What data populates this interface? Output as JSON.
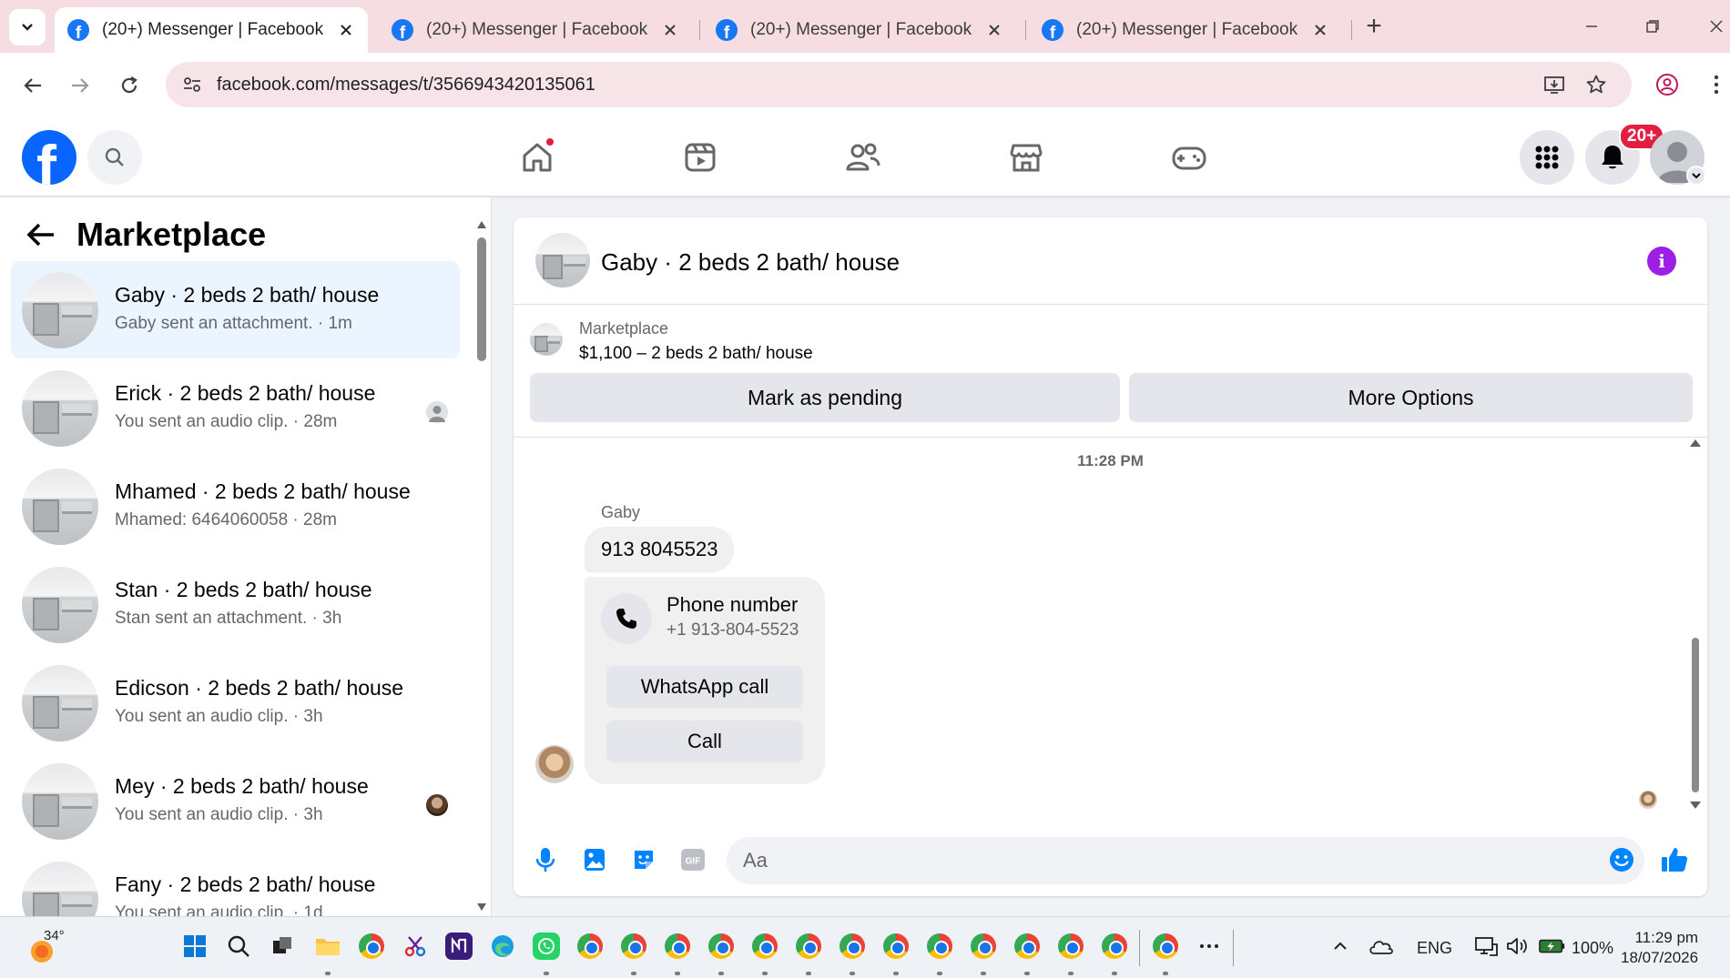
{
  "browser": {
    "tabs": [
      {
        "title": "(20+) Messenger | Facebook",
        "active": true
      },
      {
        "title": "(20+) Messenger | Facebook",
        "active": false
      },
      {
        "title": "(20+) Messenger | Facebook",
        "active": false
      },
      {
        "title": "(20+) Messenger | Facebook",
        "active": false
      }
    ],
    "favicon_letter": "f",
    "new_tab_label": "+",
    "url": "facebook.com/messages/t/3566943420135061"
  },
  "facebook": {
    "logo_letter": "f",
    "notification_badge": "20+"
  },
  "sidebar": {
    "title": "Marketplace",
    "conversations": [
      {
        "name": "Gaby · 2 beds 2 bath/ house",
        "snippet": "Gaby sent an attachment. · 1m",
        "active": true,
        "seen": "none"
      },
      {
        "name": "Erick · 2 beds 2 bath/ house",
        "snippet": "You sent an audio clip. · 28m",
        "active": false,
        "seen": "default-avatar"
      },
      {
        "name": "Mhamed · 2 beds 2 bath/ house",
        "snippet": "Mhamed: 6464060058 · 28m",
        "active": false,
        "seen": "none"
      },
      {
        "name": "Stan · 2 beds 2 bath/ house",
        "snippet": "Stan sent an attachment. · 3h",
        "active": false,
        "seen": "none"
      },
      {
        "name": "Edicson · 2 beds 2 bath/ house",
        "snippet": "You sent an audio clip. · 3h",
        "active": false,
        "seen": "none"
      },
      {
        "name": "Mey · 2 beds 2 bath/ house",
        "snippet": "You sent an audio clip. · 3h",
        "active": false,
        "seen": "photo-avatar"
      },
      {
        "name": "Fany · 2 beds 2 bath/ house",
        "snippet": "You sent an audio clip. · 1d",
        "active": false,
        "seen": "none"
      }
    ]
  },
  "chat": {
    "title": "Gaby · 2 beds 2 bath/ house",
    "info_label": "i",
    "marketplace": {
      "label": "Marketplace",
      "listing": "$1,100 – 2 beds 2 bath/ house",
      "mark_pending": "Mark as pending",
      "more_options": "More Options"
    },
    "timestamp": "11:28 PM",
    "sender": "Gaby",
    "message": "913 8045523",
    "phone_card": {
      "title": "Phone number",
      "number": "+1 913-804-5523",
      "whatsapp": "WhatsApp call",
      "call": "Call"
    },
    "composer": {
      "placeholder": "Aa",
      "gif_label": "GIF"
    }
  },
  "taskbar": {
    "temperature": "34°",
    "language": "ENG",
    "battery": "100%",
    "time": "11:29 pm",
    "date": "18/07/2026"
  },
  "colors": {
    "facebook_blue": "#0866ff",
    "messenger_blue": "#0084ff",
    "badge_red": "#e41e3f",
    "info_purple": "#9d1fe6",
    "tab_strip": "#f6dde2",
    "active_conversation": "#ebf5ff"
  }
}
